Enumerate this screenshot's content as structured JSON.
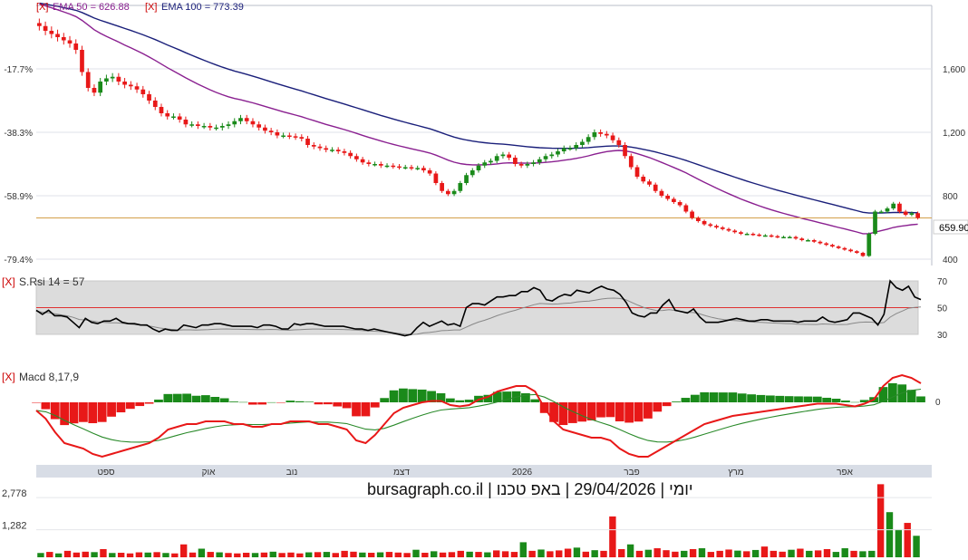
{
  "chart_data": {
    "type": "financial-chart",
    "colors": {
      "up": "#1a8a1a",
      "down": "#e81818",
      "ema50": "#8a2090",
      "ema100": "#1a1f7a",
      "last_line": "#d4a04a",
      "rsi": "#000000",
      "rsi_signal": "#888888",
      "rsi_mid": "#e03030",
      "macd": "#e81818",
      "macd_signal": "#2a8a2a",
      "volume_up": "#1a8a1a",
      "volume_down": "#e81818",
      "marker": "#cc0000"
    },
    "price_panel": {
      "marker": "[X]",
      "ema50_label": "EMA 50 = 626.88",
      "ema100_label": "EMA 100 = 773.39",
      "right_ticks": [
        "1,600",
        "1,200",
        "800",
        "400"
      ],
      "left_ticks": [
        "-17.7%",
        "-38.3%",
        "-58.9%",
        "-79.4%"
      ],
      "last_price_label": "659.90",
      "last_price": 659.9,
      "ylim": [
        360,
        2000
      ],
      "close": [
        1870,
        1840,
        1820,
        1800,
        1780,
        1760,
        1720,
        1580,
        1480,
        1450,
        1520,
        1540,
        1550,
        1520,
        1500,
        1490,
        1470,
        1440,
        1400,
        1360,
        1320,
        1300,
        1300,
        1280,
        1250,
        1250,
        1240,
        1240,
        1230,
        1230,
        1240,
        1250,
        1270,
        1290,
        1270,
        1250,
        1230,
        1210,
        1200,
        1180,
        1180,
        1175,
        1170,
        1160,
        1120,
        1110,
        1100,
        1090,
        1090,
        1080,
        1070,
        1050,
        1030,
        1010,
        1000,
        1000,
        990,
        990,
        985,
        980,
        980,
        975,
        975,
        960,
        940,
        880,
        830,
        810,
        830,
        880,
        930,
        960,
        990,
        1010,
        1020,
        1050,
        1060,
        1040,
        1000,
        990,
        1000,
        1010,
        1030,
        1050,
        1060,
        1080,
        1100,
        1100,
        1120,
        1140,
        1170,
        1200,
        1190,
        1180,
        1150,
        1120,
        1050,
        980,
        920,
        890,
        870,
        830,
        800,
        780,
        760,
        740,
        700,
        660,
        640,
        620,
        610,
        600,
        590,
        580,
        570,
        560,
        560,
        555,
        550,
        550,
        545,
        540,
        540,
        540,
        530,
        520,
        520,
        510,
        500,
        490,
        480,
        470,
        460,
        450,
        440,
        420,
        560,
        700,
        700,
        720,
        750,
        700,
        680,
        690,
        660
      ]
    },
    "rsi_panel": {
      "marker": "[X]",
      "label": "S.Rsi 14 = 57",
      "right_ticks": [
        "70",
        "50",
        "30"
      ],
      "levels": [
        70,
        50,
        30
      ],
      "ylim": [
        30,
        70
      ],
      "values": [
        48,
        45,
        48,
        44,
        44,
        43,
        39,
        35,
        42,
        39,
        38,
        40,
        40,
        42,
        39,
        38,
        38,
        37,
        37,
        34,
        32,
        34,
        33,
        33,
        37,
        36,
        35,
        37,
        37,
        38,
        38,
        37,
        36,
        36,
        36,
        36,
        35,
        37,
        37,
        36,
        34,
        34,
        38,
        37,
        38,
        38,
        37,
        36,
        36,
        36,
        36,
        35,
        34,
        34,
        33,
        34,
        33,
        32,
        31,
        30,
        29,
        30,
        35,
        39,
        36,
        38,
        40,
        37,
        38,
        36,
        50,
        53,
        53,
        52,
        55,
        58,
        58,
        59,
        59,
        62,
        62,
        65,
        63,
        56,
        55,
        58,
        60,
        59,
        63,
        62,
        61,
        64,
        66,
        64,
        63,
        60,
        54,
        46,
        44,
        43,
        46,
        46,
        52,
        56,
        48,
        47,
        46,
        49,
        43,
        39,
        39,
        39,
        40,
        41,
        42,
        41,
        40,
        40,
        41,
        41,
        40,
        40,
        40,
        40,
        39,
        40,
        40,
        40,
        43,
        40,
        39,
        40,
        41,
        46,
        46,
        44,
        42,
        37,
        45,
        70,
        65,
        63,
        66,
        58,
        56
      ]
    },
    "macd_panel": {
      "marker": "[X]",
      "label": "Macd 8,17,9",
      "right_ticks": [
        "0"
      ],
      "ylim": [
        -2.2,
        1.4
      ],
      "macd": [
        -0.3,
        -0.6,
        -1.1,
        -1.5,
        -1.6,
        -1.7,
        -1.9,
        -2.0,
        -1.9,
        -1.8,
        -1.7,
        -1.6,
        -1.5,
        -1.3,
        -1.0,
        -0.9,
        -0.8,
        -0.8,
        -0.7,
        -0.7,
        -0.7,
        -0.8,
        -0.8,
        -0.9,
        -0.9,
        -0.8,
        -0.8,
        -0.7,
        -0.7,
        -0.7,
        -0.8,
        -0.8,
        -0.9,
        -1.0,
        -1.4,
        -1.5,
        -1.2,
        -0.8,
        -0.4,
        -0.2,
        -0.1,
        0.0,
        0.05,
        0.05,
        -0.1,
        -0.15,
        -0.1,
        0.1,
        0.2,
        0.4,
        0.5,
        0.6,
        0.6,
        0.4,
        -0.2,
        -0.7,
        -1.0,
        -1.1,
        -1.2,
        -1.3,
        -1.3,
        -1.4,
        -1.7,
        -1.9,
        -2.0,
        -2.0,
        -1.8,
        -1.6,
        -1.4,
        -1.2,
        -1.0,
        -0.8,
        -0.7,
        -0.6,
        -0.5,
        -0.45,
        -0.4,
        -0.35,
        -0.3,
        -0.25,
        -0.2,
        -0.15,
        -0.1,
        -0.05,
        -0.05,
        -0.05,
        -0.1,
        -0.15,
        -0.05,
        0.1,
        0.6,
        0.9,
        1.0,
        0.9,
        0.7
      ]
    },
    "x_axis": {
      "labels": [
        "ספט",
        "אוק",
        "נוב",
        "דצמ",
        "2026",
        "פבר",
        "מרץ",
        "אפר"
      ]
    },
    "volume_panel": {
      "title": "יומי | 29/04/2026 | באפ טכנו | bursagraph.co.il",
      "right_ticks": [
        "2,778",
        "1,282"
      ],
      "ylim": [
        0,
        3500
      ],
      "values": [
        200,
        250,
        180,
        300,
        220,
        260,
        240,
        380,
        200,
        210,
        180,
        230,
        220,
        240,
        200,
        180,
        600,
        220,
        400,
        250,
        230,
        200,
        180,
        210,
        200,
        220,
        260,
        200,
        220,
        180,
        230,
        240,
        250,
        200,
        300,
        260,
        220,
        210,
        230,
        250,
        220,
        200,
        350,
        210,
        280,
        220,
        240,
        300,
        260,
        250,
        230,
        320,
        280,
        250,
        700,
        300,
        360,
        280,
        320,
        400,
        450,
        260,
        330,
        300,
        1900,
        380,
        600,
        300,
        350,
        420,
        330,
        260,
        300,
        380,
        420,
        250,
        300,
        360,
        310,
        280,
        340,
        500,
        300,
        260,
        350,
        400,
        300,
        320,
        380,
        250,
        420,
        300,
        280,
        300,
        3400,
        2100,
        1300,
        1600,
        1000
      ]
    }
  }
}
